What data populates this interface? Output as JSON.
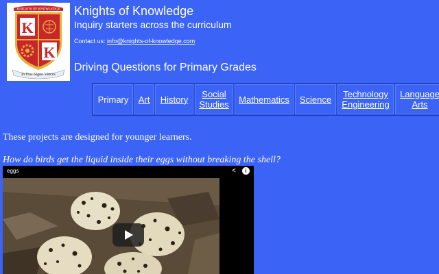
{
  "brand": {
    "logo_lettering": "KNIGHTS OF KNOWLEDGE",
    "logo_motto": "In Hoc Signo Vinces",
    "logo_letters": [
      "K",
      "K",
      "K"
    ],
    "colors": {
      "background": "#3b63f5",
      "shield_red": "#c9262c",
      "shield_gold": "#e4b13a"
    }
  },
  "header": {
    "title": "Knights of Knowledge",
    "tagline": "Inquiry starters across the curriculum",
    "contact_label": "Contact us: ",
    "contact_email": "info@knights-of-knowledge.com",
    "page_title": "Driving Questions for Primary Grades"
  },
  "nav": {
    "items": [
      {
        "label": "Primary",
        "active": true
      },
      {
        "label": "Art"
      },
      {
        "label": "History"
      },
      {
        "label": "Social Studies"
      },
      {
        "label": "Mathematics"
      },
      {
        "label": "Science"
      },
      {
        "label": "Technology Engineering"
      },
      {
        "label": "Language Arts"
      }
    ]
  },
  "content": {
    "intro": "These projects are designed for younger learners.",
    "question": "How do birds get the liquid inside their eggs without breaking the shell?"
  },
  "video": {
    "title": "eggs",
    "icons": [
      "share-icon",
      "info-icon",
      "play-icon"
    ]
  }
}
